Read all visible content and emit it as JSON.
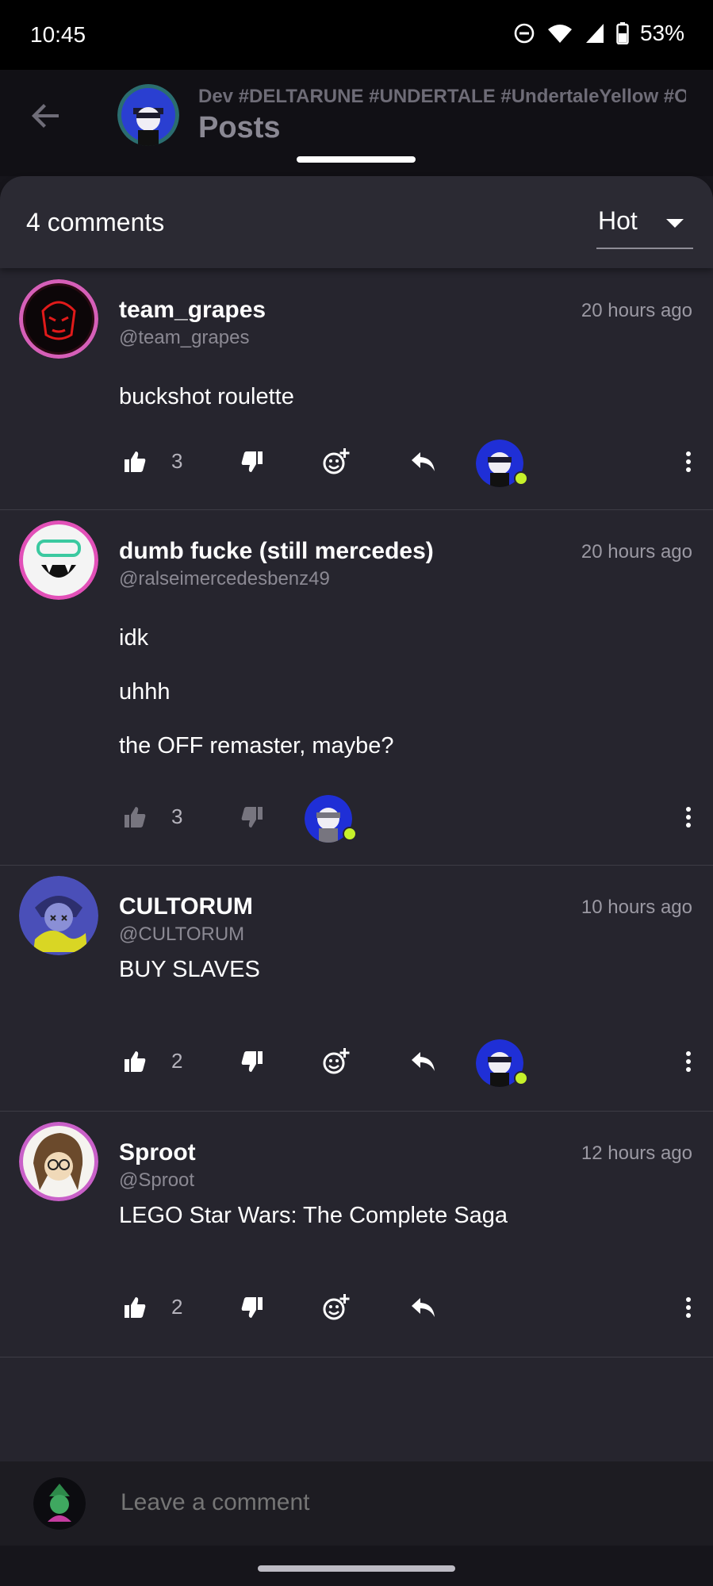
{
  "status_bar": {
    "time": "10:45",
    "battery": "53%",
    "icons": [
      "do-not-disturb-icon",
      "wifi-icon",
      "signal-icon",
      "battery-icon"
    ]
  },
  "header": {
    "subtitle": "Dev #DELTARUNE #UNDERTALE #UndertaleYellow #O",
    "title": "Posts",
    "back_icon": "arrow-left-icon"
  },
  "comments_header": {
    "count_label": "4 comments",
    "sort_value": "Hot"
  },
  "comments": [
    {
      "name": "team_grapes",
      "handle": "@team_grapes",
      "time": "20 hours ago",
      "lines": [
        "buckshot roulette"
      ],
      "likes": "3",
      "reactions_enabled": true
    },
    {
      "name": "dumb fucke (still mercedes)",
      "handle": "@ralseimercedesbenz49",
      "time": "20 hours ago",
      "lines": [
        "idk",
        "uhhh",
        "the OFF remaster, maybe?"
      ],
      "likes": "3",
      "reactions_enabled": false
    },
    {
      "name": "CULTORUM",
      "handle": "@CULTORUM",
      "time": "10 hours ago",
      "lines": [
        "BUY SLAVES"
      ],
      "likes": "2",
      "reactions_enabled": true
    },
    {
      "name": "Sproot",
      "handle": "@Sproot",
      "time": "12 hours ago",
      "lines": [
        "LEGO Star Wars: The Complete Saga"
      ],
      "likes": "2",
      "reactions_enabled": true
    }
  ],
  "compose": {
    "placeholder": "Leave a comment"
  },
  "colors": {
    "background": "#16151b",
    "sheet": "#26252e",
    "accent_heart": "#c6f12a",
    "avatar_blue": "#1f2fd6"
  }
}
